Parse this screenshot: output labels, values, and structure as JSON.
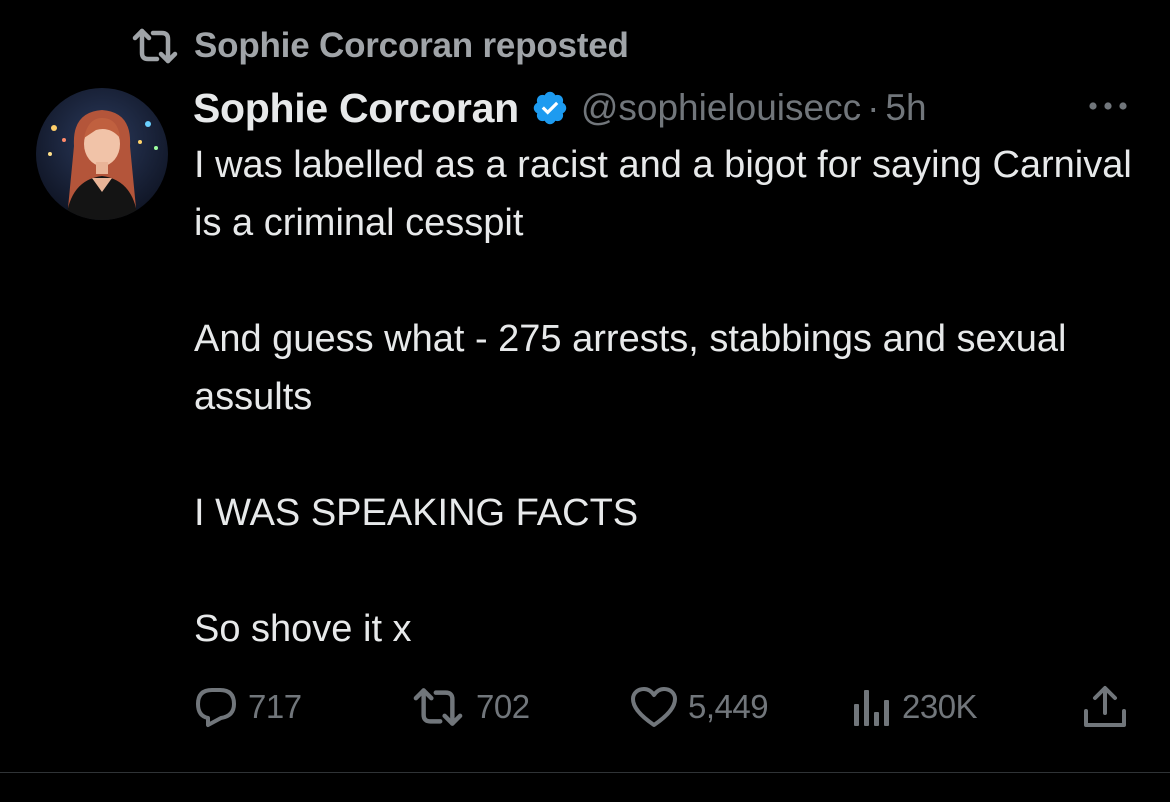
{
  "repost": {
    "label": "Sophie Corcoran reposted",
    "icon": "repost-icon"
  },
  "author": {
    "display_name": "Sophie Corcoran",
    "handle": "@sophielouisecc",
    "separator": "·",
    "time": "5h",
    "verified": true,
    "verified_color": "#1d9bf0"
  },
  "tweet": {
    "paragraphs": [
      "I was labelled as a racist and a bigot for saying Carnival is a criminal cesspit",
      "And guess what - 275 arrests, stabbings and sexual assults",
      "I WAS SPEAKING FACTS",
      "So shove it x"
    ]
  },
  "actions": {
    "replies": {
      "icon": "reply-icon",
      "count": "717"
    },
    "reposts": {
      "icon": "repost-icon",
      "count": "702"
    },
    "likes": {
      "icon": "heart-icon",
      "count": "5,449"
    },
    "views": {
      "icon": "views-icon",
      "count": "230K"
    },
    "share": {
      "icon": "share-icon"
    }
  },
  "colors": {
    "background": "#000000",
    "primary_text": "#e7e9ea",
    "secondary_text": "#71767b",
    "accent": "#1d9bf0"
  }
}
